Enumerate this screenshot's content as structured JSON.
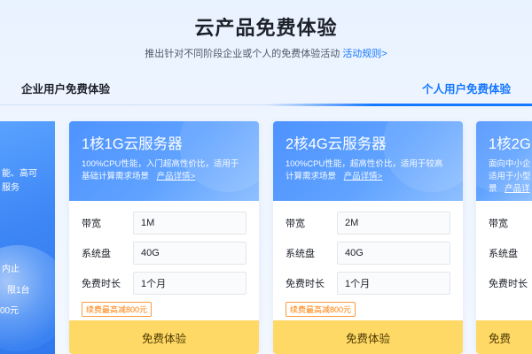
{
  "header": {
    "title": "云产品免费体验",
    "subtitle": "推出针对不同阶段企业或个人的免费体验活动",
    "rules_link": "活动规则>"
  },
  "tabs": [
    {
      "label": "企业用户免费体验",
      "active": false
    },
    {
      "label": "个人用户免费体验",
      "active": true
    }
  ],
  "enterprise_card": {
    "lines": [
      "能、高可",
      "服务",
      "内止",
      "限1台",
      "00元"
    ]
  },
  "cards": [
    {
      "title": "1核1G云服务器",
      "desc": "100%CPU性能，入门超高性价比，适用于基础计算需求场景",
      "detail_link": "产品详情>",
      "specs": [
        {
          "label": "带宽",
          "value": "1M"
        },
        {
          "label": "系统盘",
          "value": "40G"
        },
        {
          "label": "免费时长",
          "value": "1个月"
        }
      ],
      "promo": "续费最高减800元",
      "button": "免费体验"
    },
    {
      "title": "2核4G云服务器",
      "desc": "100%CPU性能，超高性价比，适用于较高计算需求场景",
      "detail_link": "产品详情>",
      "specs": [
        {
          "label": "带宽",
          "value": "2M"
        },
        {
          "label": "系统盘",
          "value": "40G"
        },
        {
          "label": "免费时长",
          "value": "1个月"
        }
      ],
      "promo": "续费最高减800元",
      "button": "免费体验"
    },
    {
      "title": "1核2G",
      "desc_line1": "面向中小企",
      "desc_line2": "适用于小型",
      "detail_prefix": "景",
      "detail_link": "产品详",
      "specs": [
        {
          "label": "带宽",
          "value": ""
        },
        {
          "label": "系统盘",
          "value": ""
        },
        {
          "label": "免费时长",
          "value": ""
        }
      ],
      "button": "免费"
    }
  ],
  "colors": {
    "accent": "#1677ff",
    "card_head": "#4e93ff",
    "button": "#ffd966",
    "promo": "#ff7d00"
  }
}
